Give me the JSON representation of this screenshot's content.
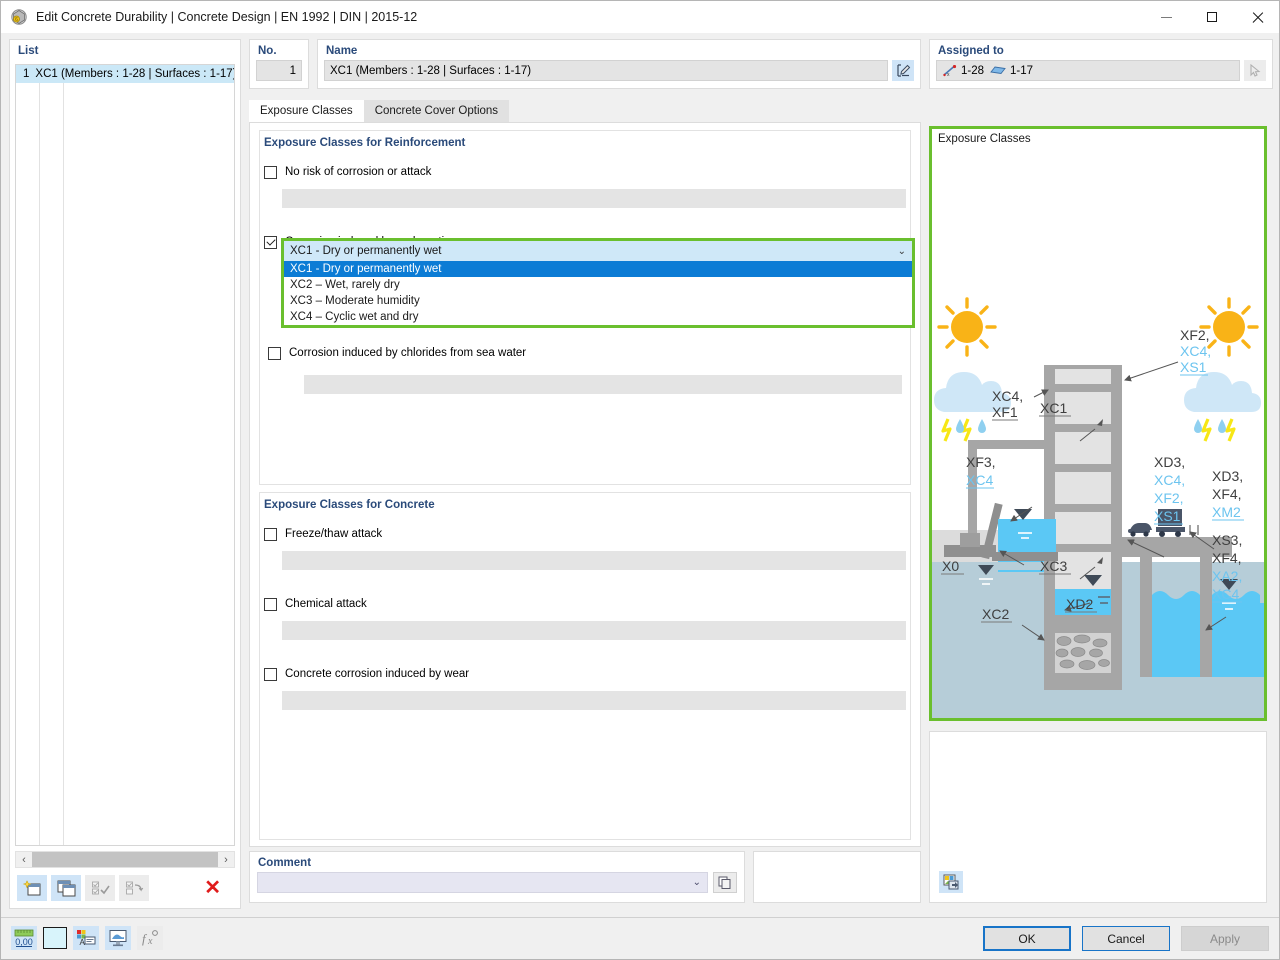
{
  "window": {
    "title": "Edit Concrete Durability | Concrete Design | EN 1992 | DIN | 2015-12",
    "icon": "concrete-durability-icon",
    "minimize": "–",
    "maximize": "□",
    "close": "✕"
  },
  "list_panel": {
    "label": "List",
    "rows": [
      {
        "num": "1",
        "name": "XC1 (Members : 1-28 | Surfaces : 1-17)"
      }
    ],
    "scroll_left": "‹",
    "scroll_right": "›",
    "toolbar": [
      {
        "name": "new-item-button",
        "icon": "new-window-icon",
        "enabled": true
      },
      {
        "name": "copy-item-button",
        "icon": "copy-window-icon",
        "enabled": true
      },
      {
        "name": "select-all-button",
        "icon": "check-all-icon",
        "enabled": false
      },
      {
        "name": "invert-selection-button",
        "icon": "invert-selection-icon",
        "enabled": false
      }
    ],
    "delete_label": "✕"
  },
  "no_field": {
    "label": "No.",
    "value": "1"
  },
  "name_field": {
    "label": "Name",
    "value": "XC1 (Members : 1-28 | Surfaces : 1-17)",
    "edit_button_icon": "edit-pencil-icon"
  },
  "assigned_to": {
    "label": "Assigned to",
    "members": "1-28",
    "surfaces": "1-17",
    "pick_button_icon": "select-pointer-icon"
  },
  "tabs": [
    {
      "label": "Exposure Classes",
      "active": true
    },
    {
      "label": "Concrete Cover Options",
      "active": false
    }
  ],
  "reinforcement": {
    "title": "Exposure Classes for Reinforcement",
    "items": [
      {
        "label": "No risk of corrosion or attack",
        "checked": false,
        "field_enabled": false
      },
      {
        "label": "Corrosion induced by carbonation",
        "checked": true,
        "field_enabled": true
      },
      {
        "label": "Corrosion induced by chlorides from sea water",
        "checked": false,
        "field_enabled": false
      }
    ]
  },
  "carbonation_combo": {
    "selected": "XC1 - Dry or permanently wet",
    "caret": "⌄",
    "options": [
      {
        "label": "XC1 - Dry or permanently wet",
        "selected": true
      },
      {
        "label": "XC2 – Wet, rarely dry",
        "selected": false
      },
      {
        "label": "XC3 – Moderate humidity",
        "selected": false
      },
      {
        "label": "XC4 – Cyclic wet and dry",
        "selected": false
      }
    ]
  },
  "concrete": {
    "title": "Exposure Classes for Concrete",
    "items": [
      {
        "label": "Freeze/thaw attack",
        "checked": false
      },
      {
        "label": "Chemical attack",
        "checked": false
      },
      {
        "label": "Concrete corrosion induced by wear",
        "checked": false
      }
    ]
  },
  "comment": {
    "label": "Comment",
    "value": "",
    "placeholder": "",
    "caret": "⌄",
    "button_icon": "copy-pages-icon"
  },
  "illustration": {
    "title": "Exposure Classes",
    "export_button_icon": "save-image-icon",
    "labels": [
      {
        "name": "XC1",
        "lines": [
          "XC1"
        ],
        "colors": [
          "dark"
        ]
      },
      {
        "name": "XC2",
        "lines": [
          "XC2"
        ],
        "colors": [
          "dark"
        ]
      },
      {
        "name": "XC3",
        "lines": [
          "XC3"
        ],
        "colors": [
          "dark"
        ]
      },
      {
        "name": "XD2",
        "lines": [
          "XD2"
        ],
        "colors": [
          "dark"
        ]
      },
      {
        "name": "X0",
        "lines": [
          "X0"
        ],
        "colors": [
          "dark"
        ]
      },
      {
        "name": "XF2-group",
        "lines": [
          "XF2,",
          "XC4,",
          "XS1"
        ],
        "colors": [
          "dark",
          "light",
          "light"
        ]
      },
      {
        "name": "XC4-XF1",
        "lines": [
          "XC4,",
          "XF1"
        ],
        "colors": [
          "dark",
          "dark"
        ]
      },
      {
        "name": "XF3-XC4",
        "lines": [
          "XF3,",
          "XC4"
        ],
        "colors": [
          "dark",
          "light"
        ]
      },
      {
        "name": "XD3-group",
        "lines": [
          "XD3,",
          "XC4,",
          "XF2,",
          "XS1"
        ],
        "colors": [
          "dark",
          "light",
          "light",
          "light"
        ]
      },
      {
        "name": "XD3-XF4-XM2",
        "lines": [
          "XD3,",
          "XF4,",
          "XM2"
        ],
        "colors": [
          "dark",
          "dark",
          "light"
        ]
      },
      {
        "name": "XS3-group",
        "lines": [
          "XS3,",
          "XF4,",
          "XA2,",
          "XC4"
        ],
        "colors": [
          "dark",
          "dark",
          "light",
          "light"
        ]
      }
    ],
    "colors": {
      "border": "#6abf2e",
      "concrete": "#a6a6a6",
      "concrete_light": "#e3e3e3",
      "water": "#5bc8f5",
      "ground": "#b6cdd8",
      "sun": "#f9b317",
      "cloud": "#cfe7f7",
      "rain": "#8fd0f0",
      "lightning": "#f7e716",
      "label_dark": "#3f3f3f",
      "label_light": "#6cc4ef"
    }
  },
  "footer": {
    "tools": [
      {
        "name": "units-button",
        "icon": "ruler-0.00-icon",
        "enabled": true
      },
      {
        "name": "color-button",
        "icon": "color-swatch-icon",
        "enabled": true
      },
      {
        "name": "display-properties-button",
        "icon": "properties-icon",
        "enabled": true
      },
      {
        "name": "view-button",
        "icon": "monitor-icon",
        "enabled": true
      },
      {
        "name": "formula-button",
        "icon": "fx-icon",
        "enabled": false
      }
    ],
    "units_text": "0,00",
    "buttons": [
      {
        "label": "OK",
        "style": "default"
      },
      {
        "label": "Cancel",
        "style": "normal"
      },
      {
        "label": "Apply",
        "style": "disabled"
      }
    ]
  }
}
